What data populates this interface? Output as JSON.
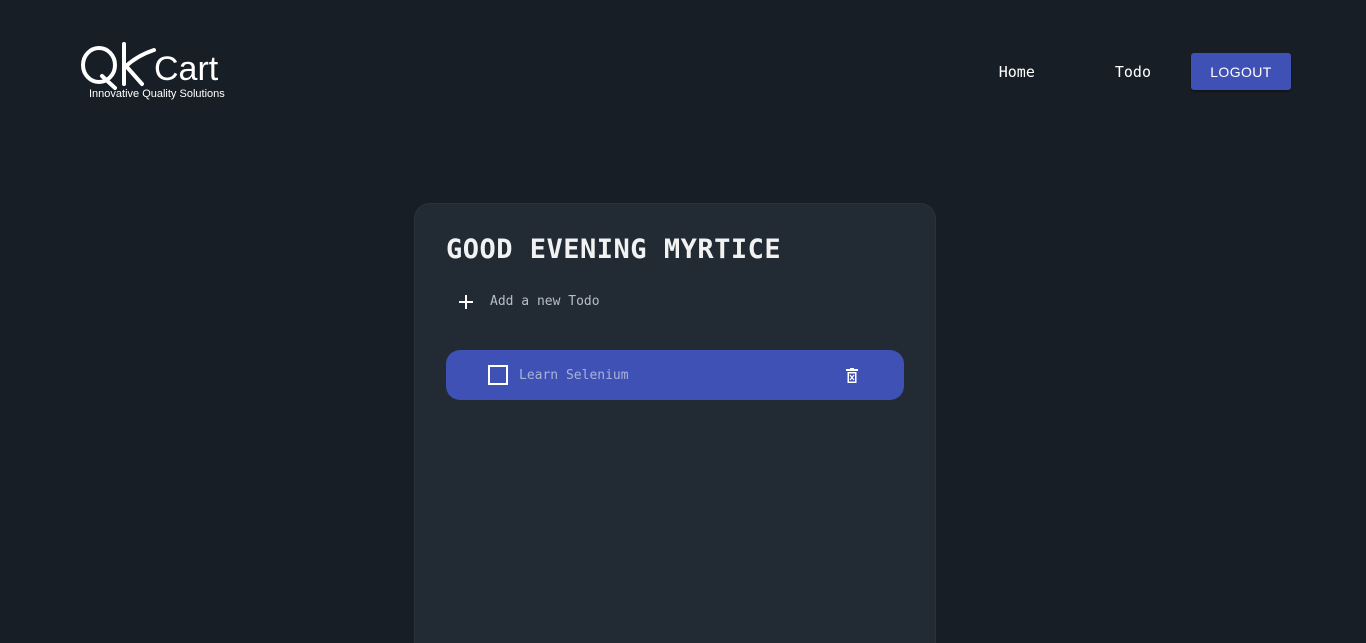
{
  "logo": {
    "wordmark": "Cart",
    "tagline": "Innovative Quality Solutions"
  },
  "nav": {
    "home_label": "Home",
    "todo_label": "Todo",
    "logout_label": "LOGOUT"
  },
  "main": {
    "greeting": "GOOD EVENING MYRTICE",
    "add_placeholder": "Add a new Todo",
    "todos": [
      {
        "text": "Learn Selenium",
        "done": false
      }
    ]
  },
  "colors": {
    "background": "#181e25",
    "card": "#222b34",
    "accent": "#3f51b5"
  }
}
